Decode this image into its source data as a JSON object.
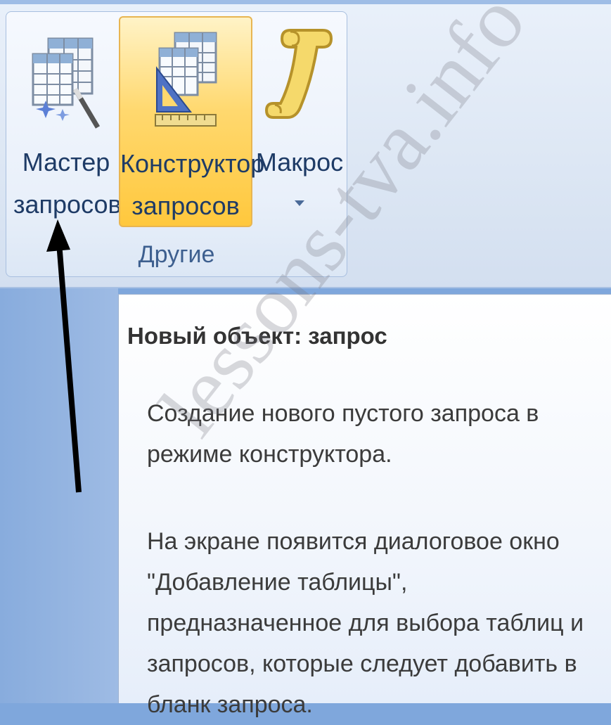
{
  "ribbon": {
    "group_label": "Другие",
    "buttons": [
      {
        "label": "Мастер\nзапросов",
        "icon": "query-wizard-icon"
      },
      {
        "label": "Конструктор\nзапросов",
        "icon": "query-design-icon"
      },
      {
        "label": "Макрос",
        "icon": "macro-scroll-icon"
      }
    ]
  },
  "tooltip": {
    "title": "Новый объект: запрос",
    "paragraph1": "Создание нового пустого запроса в режиме конструктора.",
    "paragraph2": "На экране появится диалоговое окно \"Добавление таблицы\", предназначенное для выбора таблиц и запросов, которые следует добавить в бланк запроса."
  },
  "watermark": "lessons-tva.info",
  "colors": {
    "active_button": "#ffc83d",
    "ribbon_bg": "#dde7f4",
    "pane_bg": "#88acdd"
  }
}
